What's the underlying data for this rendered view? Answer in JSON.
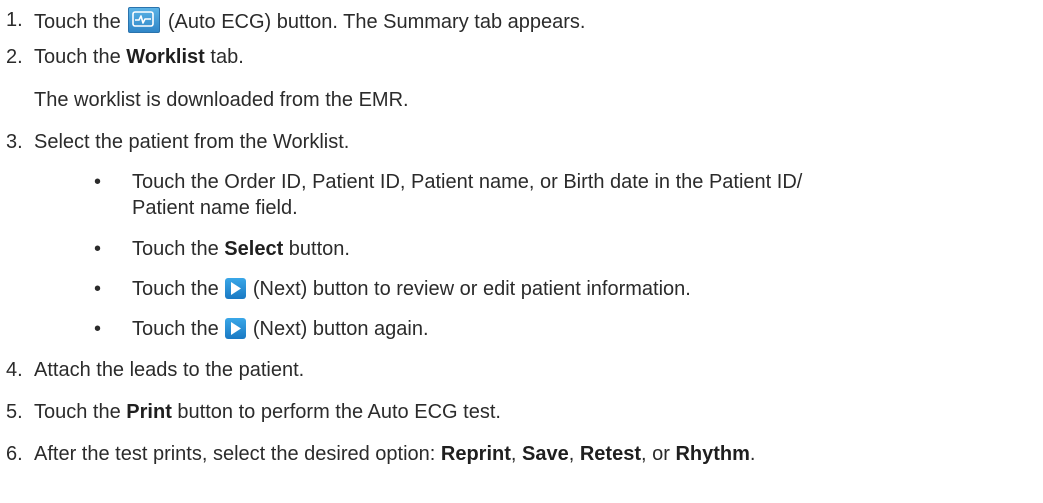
{
  "steps": [
    {
      "num": "1.",
      "pre": "Touch the",
      "icon": "auto-ecg-icon",
      "post": "(Auto ECG) button. The Summary tab appears."
    },
    {
      "num": "2.",
      "pre": "Touch the",
      "bold": "Worklist",
      "post": "tab.",
      "note": "The worklist is downloaded from the EMR."
    },
    {
      "num": "3.",
      "text": "Select the patient from the Worklist.",
      "bullets": [
        {
          "line1": "Touch the Order ID, Patient ID, Patient name, or Birth date in the Patient ID/",
          "line2": "Patient name field."
        },
        {
          "pre": "Touch the",
          "bold": "Select",
          "post": "button."
        },
        {
          "pre": "Touch the",
          "icon": "next-icon",
          "post": "(Next) button to review or edit patient information."
        },
        {
          "pre": "Touch the",
          "icon": "next-icon",
          "post": "(Next) button again."
        }
      ]
    },
    {
      "num": "4.",
      "text": "Attach the leads to the patient."
    },
    {
      "num": "5.",
      "pre": "Touch the",
      "bold": "Print",
      "post": "button to perform the Auto ECG test."
    },
    {
      "num": "6.",
      "pre": "After the test prints, select the desired option:",
      "opt1": "Reprint",
      "sep1": ",",
      "opt2": "Save",
      "sep2": ",",
      "opt3": "Retest",
      "sep3": ", or",
      "opt4": "Rhythm",
      "end": "."
    }
  ],
  "bullet_char": "•",
  "colors": {
    "text": "#2b2b2b",
    "icon_blue": "#2f86c8"
  }
}
